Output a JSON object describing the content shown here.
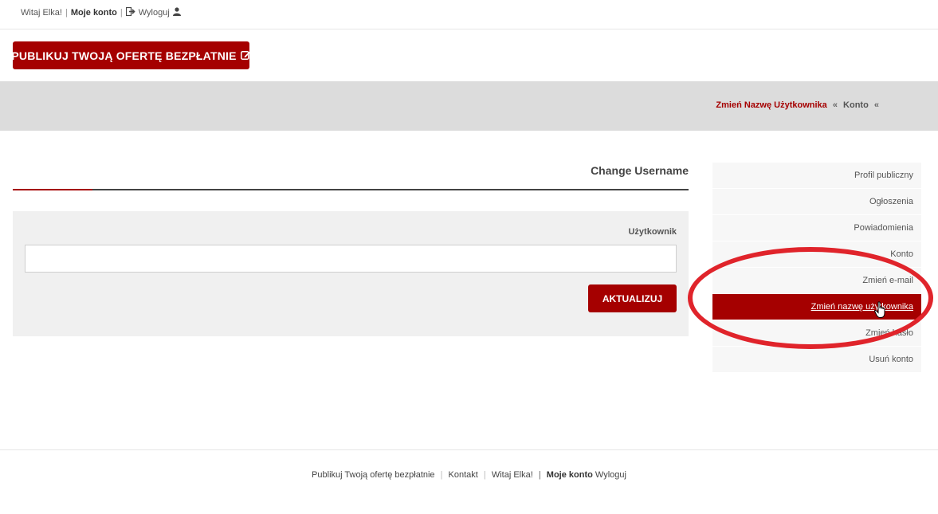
{
  "topbar": {
    "greeting": "Witaj Elka!",
    "my_account": "Moje konto",
    "logout": "Wyloguj",
    "separator": "|"
  },
  "publish_button": {
    "label": "PUBLIKUJ TWOJĄ OFERTĘ BEZPŁATNIE"
  },
  "breadcrumb": {
    "current": "Zmień Nazwę Użytkownika",
    "sep": "«",
    "parent": "Konto",
    "trail_end": "«"
  },
  "panel": {
    "title": "Change Username",
    "field_label": "Użytkownik",
    "field_value": "",
    "submit_label": "AKTUALIZUJ"
  },
  "sidebar": {
    "items": [
      {
        "label": "Profil publiczny",
        "active": false
      },
      {
        "label": "Ogłoszenia",
        "active": false
      },
      {
        "label": "Powiadomienia",
        "active": false
      },
      {
        "label": "Konto",
        "active": false
      },
      {
        "label": "Zmień e-mail",
        "active": false
      },
      {
        "label": "Zmień nazwę użytkownika",
        "active": true
      },
      {
        "label": "Zmień hasło",
        "active": false
      },
      {
        "label": "Usuń konto",
        "active": false
      }
    ]
  },
  "footer": {
    "publish": "Publikuj Twoją ofertę bezpłatnie",
    "contact": "Kontakt",
    "greeting": "Witaj Elka!",
    "separator": "|",
    "my_account": "Moje konto",
    "logout": "Wyloguj"
  },
  "colors": {
    "brand": "#a50000",
    "annotation": "#e0242b",
    "breadcrumb_bg": "#dcdcdc",
    "panel_bg": "#f0f0f0"
  },
  "icons": {
    "logout": "sign-out-icon",
    "user": "user-icon",
    "edit": "edit-icon",
    "cursor": "hand-pointer-icon"
  }
}
